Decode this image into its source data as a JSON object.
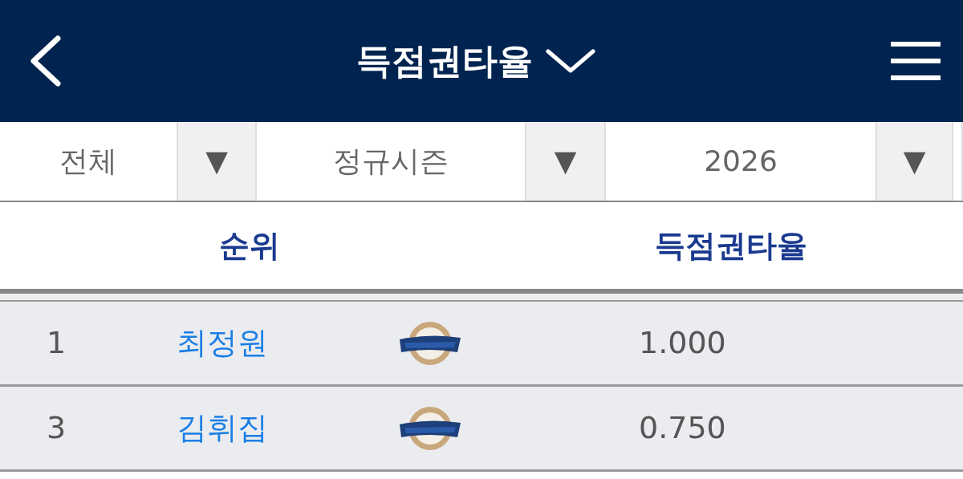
{
  "header": {
    "title": "득점권타율"
  },
  "filters": [
    {
      "value": "전체",
      "arrow": "▼"
    },
    {
      "value": "정규시즌",
      "arrow": "▼"
    },
    {
      "value": "2026",
      "arrow": "▼"
    }
  ],
  "table": {
    "columns": [
      "순위",
      "득점권타율"
    ],
    "rows": [
      {
        "rank": "1",
        "name": "최정원",
        "value": "1.000"
      },
      {
        "rank": "3",
        "name": "김휘집",
        "value": "0.750"
      }
    ]
  }
}
